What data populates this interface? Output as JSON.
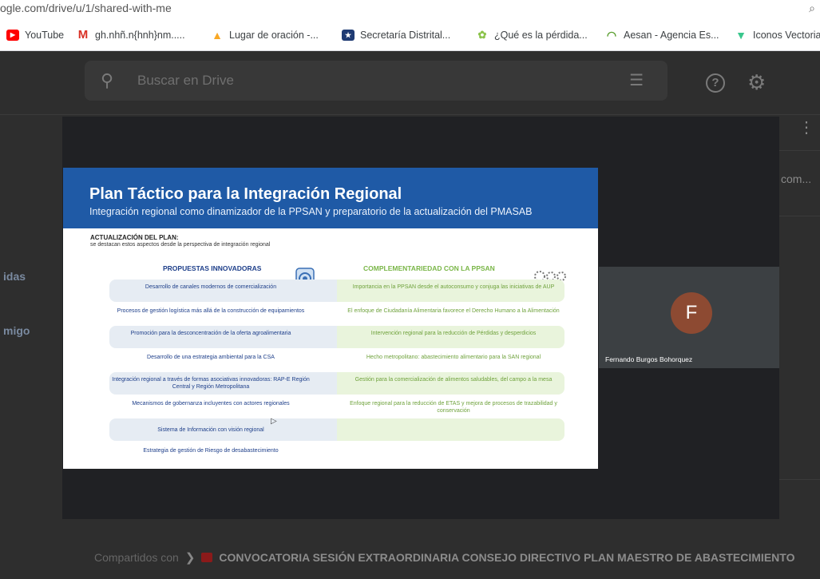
{
  "browser": {
    "url_partial": "ogle.com/drive/u/1/shared-with-me",
    "bookmarks": [
      {
        "label": "YouTube",
        "icon": "youtube-icon",
        "color": "#ff0000"
      },
      {
        "label": "gh.nhñ.n{hnh}nm.....",
        "icon": "gmail-icon",
        "color": "#d93025"
      },
      {
        "label": "Lugar de oración -...",
        "icon": "flame-icon",
        "color": "#f9a825"
      },
      {
        "label": "Secretaría Distrital...",
        "icon": "seal-icon",
        "color": "#1f3b73"
      },
      {
        "label": "¿Qué es la pérdida...",
        "icon": "leaf-icon",
        "color": "#8bc34a"
      },
      {
        "label": "Aesan - Agencia Es...",
        "icon": "aesan-icon",
        "color": "#5a9e2f"
      },
      {
        "label": "Iconos Vectoria",
        "icon": "vector-icon",
        "color": "#3ac78d"
      }
    ]
  },
  "drive": {
    "search_placeholder": "Buscar en Drive",
    "side_items": [
      "idas",
      "migo"
    ],
    "row_truncated": "com...",
    "breadcrumb_root": "Compartidos con",
    "breadcrumb_folder": "CONVOCATORIA SESIÓN EXTRAORDINARIA CONSEJO DIRECTIVO PLAN MAESTRO DE ABASTECIMIENTO"
  },
  "slide": {
    "title": "Plan Táctico para la Integración Regional",
    "subtitle": "Integración regional como dinamizador de la PPSAN y preparatorio de la actualización del PMASAB",
    "section_title": "ACTUALIZACIÓN DEL PLAN:",
    "section_note": "se destacan estos aspectos desde la perspectiva de integración regional",
    "left_heading": "PROPUESTAS INNOVADORAS",
    "right_heading": "COMPLEMENTARIEDAD CON LA PPSAN",
    "left_items": [
      "Desarrollo de canales modernos de comercialización",
      "Procesos de gestión logística más allá de la construcción de equipamientos",
      "Promoción para la desconcentración de la oferta agroalimentaria",
      "Desarrollo de una estrategia ambiental para la CSA",
      "Integración regional a través de formas asociativas innovadoras: RAP-E Región Central y Región Metropolitana",
      "Mecanismos de gobernanza incluyentes con actores regionales",
      "Sistema de Información con visión regional",
      "Estrategia de gestión de Riesgo de desabastecimiento"
    ],
    "right_items": [
      "Importancia en la PPSAN desde el autoconsumo y conjuga las iniciativas de AUP",
      "El enfoque de Ciudadanía Alimentaria favorece el Derecho Humano a la Alimentación",
      "Intervención regional para la reducción de Pérdidas y desperdicios",
      "Hecho metropolitano: abastecimiento alimentario para la SAN regional",
      "Gestión para la comercialización de alimentos saludables, del campo a la mesa",
      "Enfoque regional para la reducción de ETAS y mejora de procesos de trazabilidad y conservación"
    ]
  },
  "meeting": {
    "participant_initial": "F",
    "participant_name": "Fernando Burgos Bohorquez",
    "avatar_color": "#8d4a32"
  }
}
